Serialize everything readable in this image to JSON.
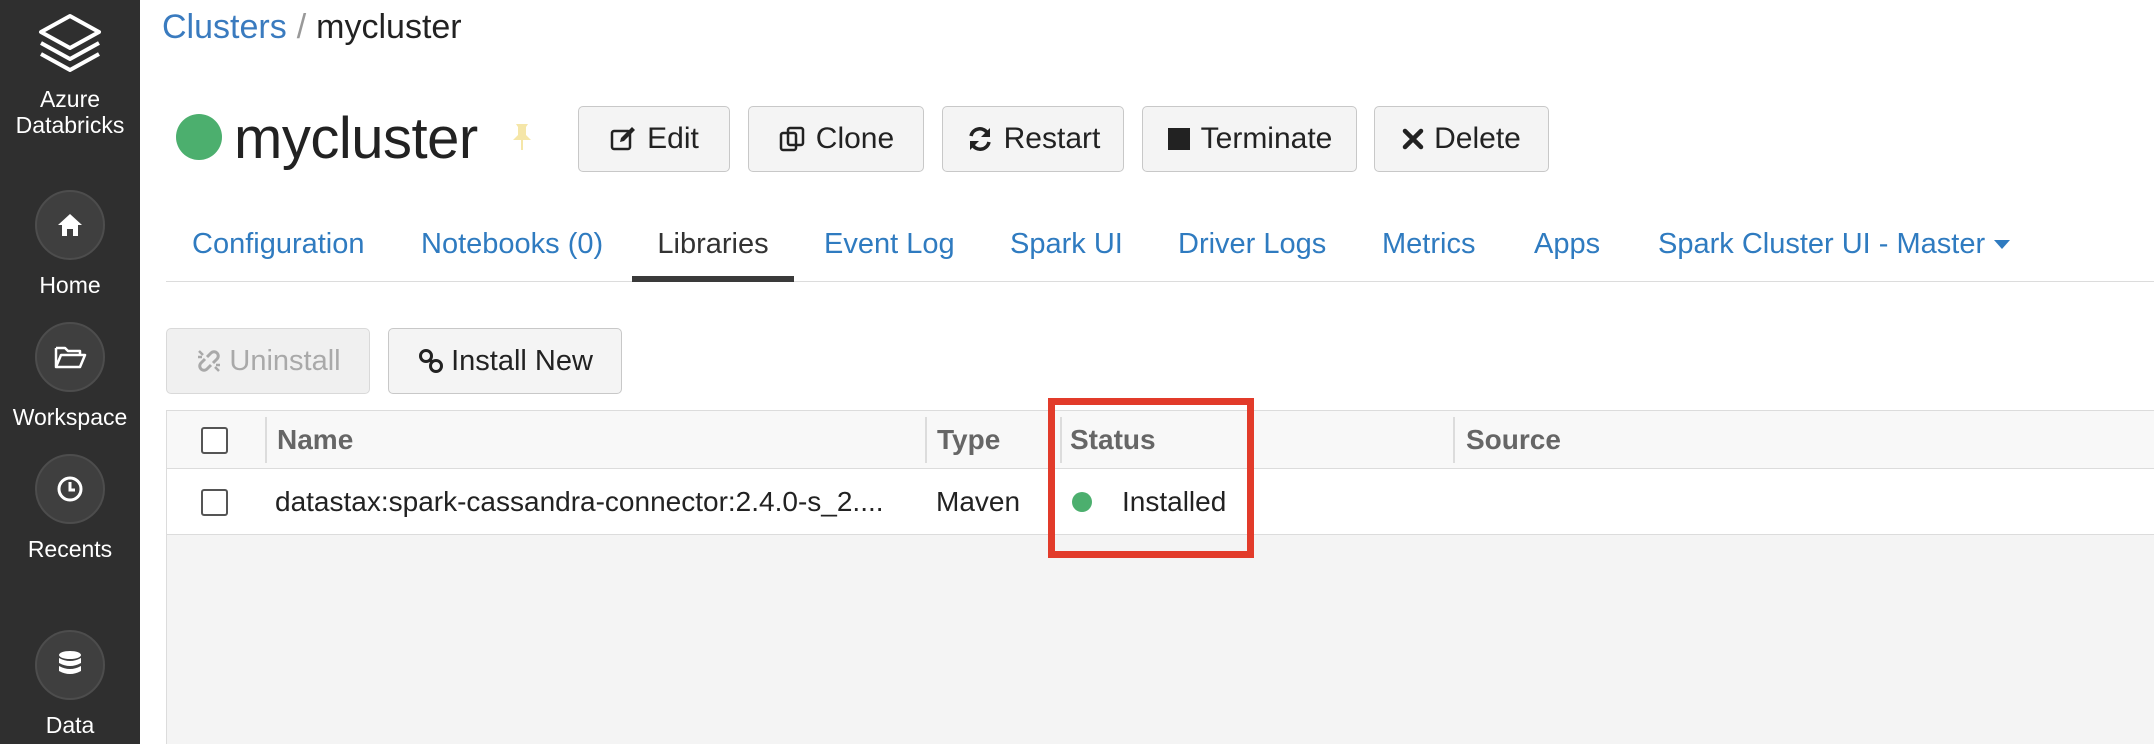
{
  "sidebar": {
    "brand": {
      "line1": "Azure",
      "line2": "Databricks",
      "icon": "databricks-layers-icon"
    },
    "items": [
      {
        "label": "Home",
        "icon": "home-icon"
      },
      {
        "label": "Workspace",
        "icon": "folder-open-icon"
      },
      {
        "label": "Recents",
        "icon": "clock-icon"
      },
      {
        "label": "Data",
        "icon": "database-icon"
      }
    ]
  },
  "breadcrumb": {
    "parent": "Clusters",
    "separator": "/",
    "current": "mycluster"
  },
  "cluster": {
    "name": "mycluster",
    "status_color": "#4caf6e"
  },
  "actions": {
    "edit": "Edit",
    "clone": "Clone",
    "restart": "Restart",
    "terminate": "Terminate",
    "delete": "Delete"
  },
  "tabs": [
    {
      "label": "Configuration"
    },
    {
      "label": "Notebooks (0)"
    },
    {
      "label": "Libraries",
      "active": true
    },
    {
      "label": "Event Log"
    },
    {
      "label": "Spark UI"
    },
    {
      "label": "Driver Logs"
    },
    {
      "label": "Metrics"
    },
    {
      "label": "Apps"
    },
    {
      "label": "Spark Cluster UI - Master"
    }
  ],
  "library_actions": {
    "uninstall": "Uninstall",
    "install_new": "Install New"
  },
  "table": {
    "headers": {
      "name": "Name",
      "type": "Type",
      "status": "Status",
      "source": "Source"
    },
    "rows": [
      {
        "name": "datastax:spark-cassandra-connector:2.4.0-s_2....",
        "type": "Maven",
        "status": "Installed",
        "source": ""
      }
    ]
  },
  "colors": {
    "accent": "#2f7bc0",
    "installed": "#4caf6e",
    "highlight": "#e23b2a",
    "sidebar": "#2f2f2f"
  }
}
